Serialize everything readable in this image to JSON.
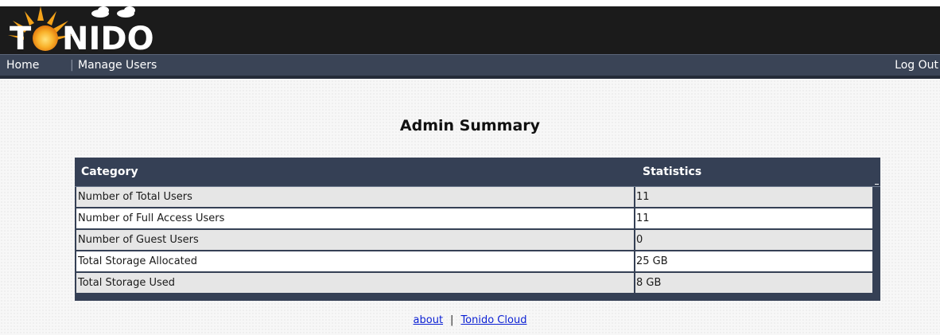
{
  "header": {
    "logo_text": "TONIDO"
  },
  "nav": {
    "home_label": "Home",
    "manage_users_label": "Manage Users",
    "logout_label": "Log Out"
  },
  "main": {
    "title": "Admin Summary",
    "table": {
      "headers": [
        "Category",
        "Statistics"
      ],
      "rows": [
        {
          "category": "Number of Total Users",
          "value": "11"
        },
        {
          "category": "Number of Full Access Users",
          "value": "11"
        },
        {
          "category": "Number of Guest Users",
          "value": "0"
        },
        {
          "category": "Total Storage Allocated",
          "value": "25 GB"
        },
        {
          "category": "Total Storage Used",
          "value": "8 GB"
        }
      ]
    }
  },
  "footer": {
    "about_label": "about",
    "separator": "|",
    "cloud_label": "Tonido Cloud"
  },
  "colors": {
    "header_bg": "#1b1b1b",
    "nav_bg": "#3a4456",
    "table_header_bg": "#354055",
    "link": "#0a1fd4",
    "logo_sun": "#f5a31a",
    "logo_text": "#ffffff"
  },
  "icons": {
    "logo": "tonido-sun-cloud-logo"
  }
}
